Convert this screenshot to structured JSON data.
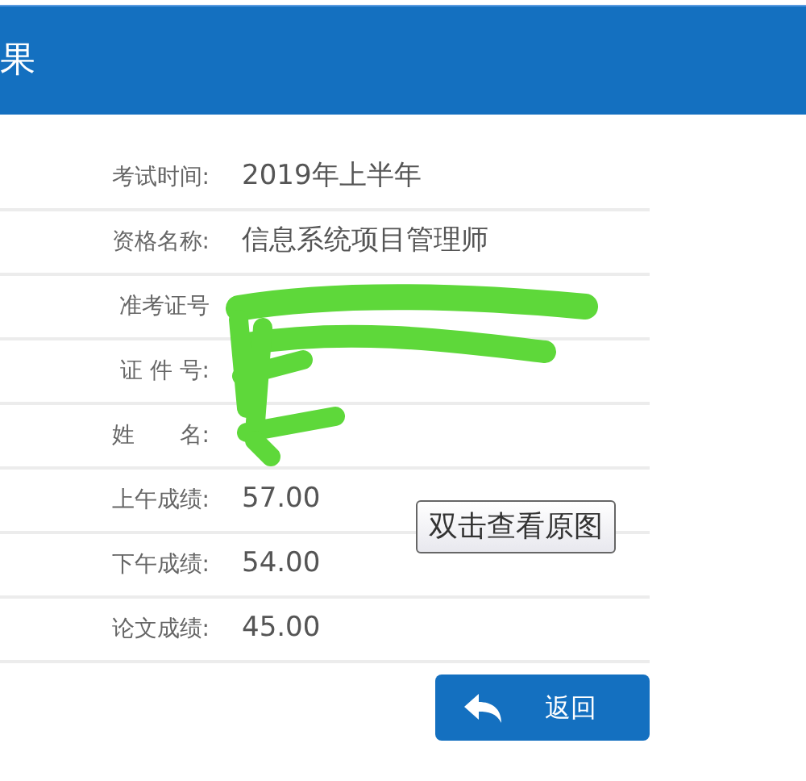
{
  "header": {
    "title": "果"
  },
  "rows": [
    {
      "label": "考试时间:",
      "value": "2019年上半年"
    },
    {
      "label": "资格名称:",
      "value": "信息系统项目管理师"
    },
    {
      "label": "准考证号",
      "value": ""
    },
    {
      "label": "证 件 号:",
      "value": ""
    },
    {
      "label": "姓　　名:",
      "value": ""
    },
    {
      "label": "上午成绩:",
      "value": "57.00"
    },
    {
      "label": "下午成绩:",
      "value": "54.00"
    },
    {
      "label": "论文成绩:",
      "value": "45.00"
    }
  ],
  "back_button": {
    "label": "返回"
  },
  "tooltip": {
    "text": "双击查看原图"
  }
}
